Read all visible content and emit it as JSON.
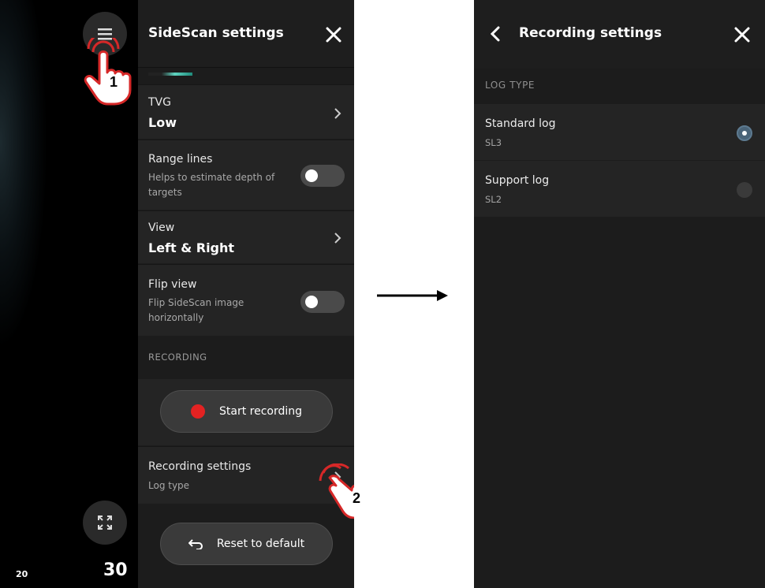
{
  "left_screen": {
    "panel_title": "SideScan settings",
    "scale": {
      "small": "20",
      "large": "30"
    },
    "rows": {
      "tvg": {
        "label": "TVG",
        "value": "Low"
      },
      "range_lines": {
        "label": "Range lines",
        "description": "Helps to estimate depth of targets",
        "toggle": "off"
      },
      "view": {
        "label": "View",
        "value": "Left & Right"
      },
      "flip_view": {
        "label": "Flip view",
        "description": "Flip SideScan image horizontally",
        "toggle": "off"
      }
    },
    "recording_section": "RECORDING",
    "start_recording_label": "Start recording",
    "recording_settings": {
      "label": "Recording settings",
      "description": "Log type"
    },
    "reset_label": "Reset to default"
  },
  "annotations": {
    "step1": "1",
    "step2": "2"
  },
  "right_screen": {
    "title": "Recording settings",
    "section_label": "LOG TYPE",
    "options": [
      {
        "title": "Standard log",
        "subtitle": "SL3",
        "selected": true
      },
      {
        "title": "Support log",
        "subtitle": "SL2",
        "selected": false
      }
    ]
  },
  "colors": {
    "record_dot": "#e32222",
    "hand_outline": "#d62828",
    "radio_selected": "#4a6478"
  }
}
